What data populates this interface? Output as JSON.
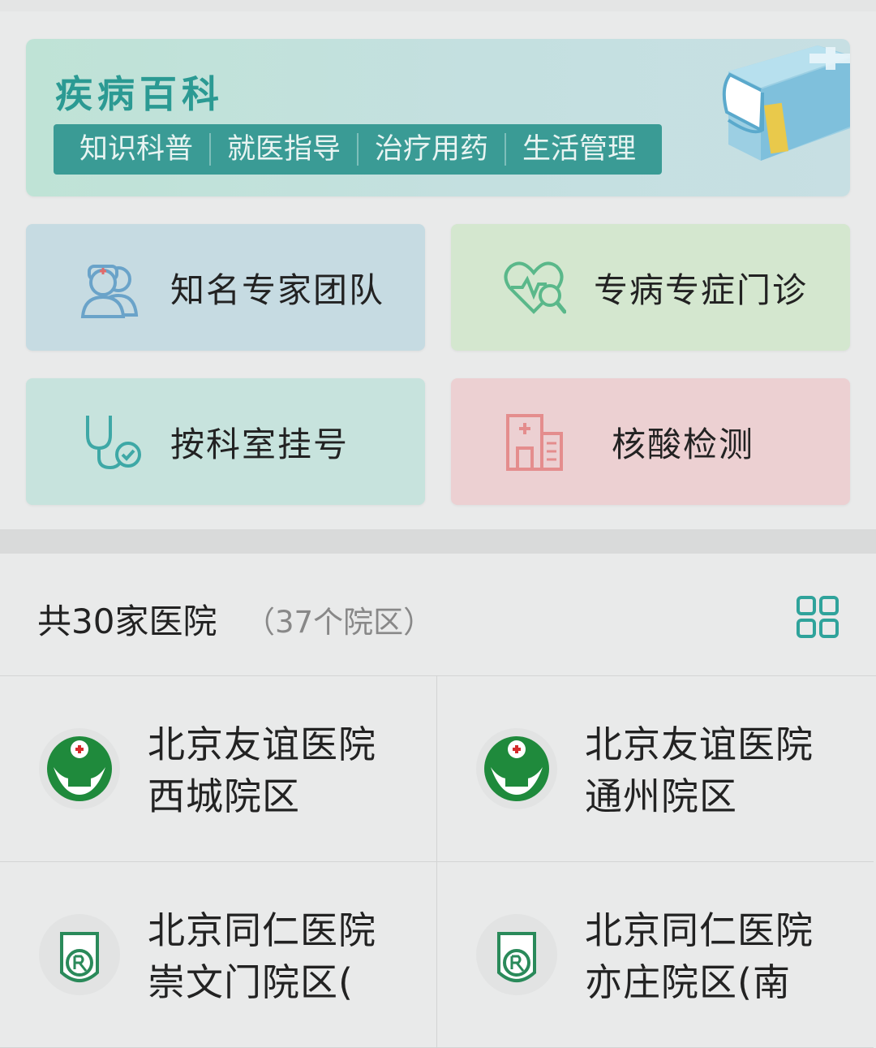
{
  "banner": {
    "title": "疾病百科",
    "tags": [
      "知识科普",
      "就医指导",
      "治疗用药",
      "生活管理"
    ]
  },
  "tiles": [
    {
      "label": "知名专家团队",
      "icon": "doctor-team-icon",
      "color": "#c6dbe2"
    },
    {
      "label": "专病专症门诊",
      "icon": "heart-pulse-search-icon",
      "color": "#d4e7cf"
    },
    {
      "label": "按科室挂号",
      "icon": "stethoscope-icon",
      "color": "#c7e3dd"
    },
    {
      "label": "核酸检测",
      "icon": "hospital-building-icon",
      "color": "#ecd0d2"
    }
  ],
  "hospitals": {
    "count_label": "共30家医院",
    "sub_label": "（37个院区）",
    "items": [
      {
        "line1": "北京友谊医院",
        "line2": "西城院区",
        "logo": "beijing-friendship-hospital-logo"
      },
      {
        "line1": "北京友谊医院",
        "line2": "通州院区",
        "logo": "beijing-friendship-hospital-logo"
      },
      {
        "line1": "北京同仁医院",
        "line2": "崇文门院区(",
        "logo": "tongren-hospital-logo"
      },
      {
        "line1": "北京同仁医院",
        "line2": "亦庄院区(南",
        "logo": "tongren-hospital-logo"
      }
    ]
  },
  "colors": {
    "accent": "#2b9a93",
    "tag_bg": "#3a9b95"
  }
}
